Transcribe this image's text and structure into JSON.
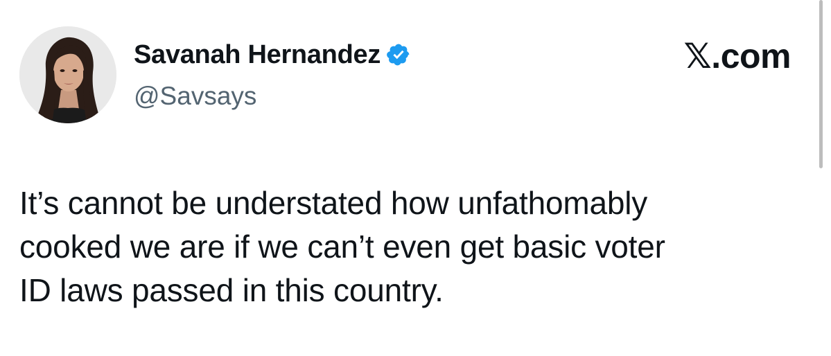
{
  "author": {
    "display_name": "Savanah Hernandez",
    "handle": "@Savsays",
    "verified": true,
    "verified_icon": "verified-badge-icon",
    "verified_color": "#1d9bf0",
    "avatar_icon": "profile-photo"
  },
  "brand": {
    "label": "𝕏.com"
  },
  "tweet": {
    "lines": [
      "It’s cannot be understated how unfathomably",
      "cooked we are if we can’t even get basic voter",
      "ID laws passed in this country."
    ]
  },
  "colors": {
    "text_primary": "#0f1419",
    "text_secondary": "#536471",
    "background": "#ffffff"
  }
}
